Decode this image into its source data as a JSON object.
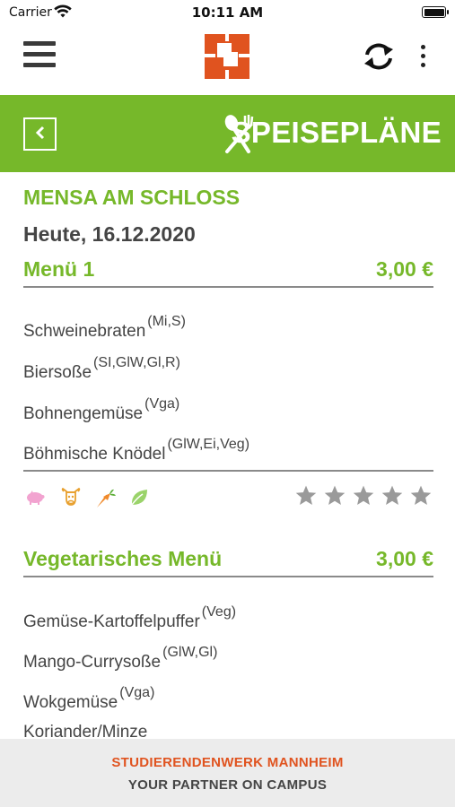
{
  "status_bar": {
    "carrier": "Carrier",
    "time": "10:11 AM"
  },
  "navbar": {
    "menu_icon": "hamburger-icon",
    "logo_icon": "studierendenwerk-logo",
    "sync_icon": "sync-icon",
    "more_icon": "more-vertical-icon"
  },
  "titlebar": {
    "title": "SPEISEPLÄNE",
    "back_icon": "chevron-left-icon",
    "title_icon": "cutlery-icon"
  },
  "canteen": {
    "name": "MENSA AM SCHLOSS",
    "date": "Heute, 16.12.2020"
  },
  "menus": [
    {
      "name": "Menü 1",
      "price": "3,00 €",
      "dishes": [
        {
          "name": "Schweinebraten",
          "allergens": "(Mi,S)"
        },
        {
          "name": "Biersoße",
          "allergens": "(SI,GlW,Gl,R)"
        },
        {
          "name": "Bohnengemüse",
          "allergens": "(Vga)"
        },
        {
          "name": "Böhmische Knödel",
          "allergens": "(GlW,Ei,Veg)"
        }
      ],
      "tags": [
        "pig-icon",
        "cow-icon",
        "carrot-icon",
        "leaf-icon"
      ],
      "rating": {
        "value": 0,
        "max": 5
      }
    },
    {
      "name": "Vegetarisches Menü",
      "price": "3,00 €",
      "dishes": [
        {
          "name": "Gemüse-Kartoffelpuffer",
          "allergens": "(Veg)"
        },
        {
          "name": "Mango-Currysoße",
          "allergens": "(GlW,Gl)"
        },
        {
          "name": "Wokgemüse",
          "allergens": "(Vga)"
        },
        {
          "name": "Koriander/Minze",
          "allergens": ""
        }
      ]
    }
  ],
  "footer": {
    "line1": "STUDIERENDENWERK MANNHEIM",
    "line2": "YOUR PARTNER ON CAMPUS"
  },
  "colors": {
    "accent": "#76b82a",
    "brand": "#e0531f",
    "text": "#444444",
    "star": "#9a9a9a"
  }
}
